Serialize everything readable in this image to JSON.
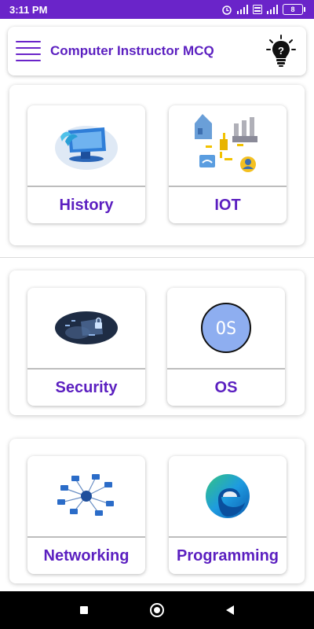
{
  "status_bar": {
    "time": "3:11 PM",
    "battery": "8",
    "icons": [
      "alarm-icon",
      "signal-icon",
      "volte-icon",
      "wifi-signal-icon",
      "battery-icon"
    ]
  },
  "app_bar": {
    "title": "Computer Instructor MCQ",
    "menu_icon": "hamburger-menu-icon",
    "action_icon": "lightbulb-idea-icon"
  },
  "categories": [
    {
      "label": "History",
      "icon": "computer-history-icon"
    },
    {
      "label": "IOT",
      "icon": "iot-network-icon"
    },
    {
      "label": "Security",
      "icon": "security-lock-icon"
    },
    {
      "label": "OS",
      "icon": "os-badge-icon",
      "badge_text": "OS"
    },
    {
      "label": "Networking",
      "icon": "network-computers-icon"
    },
    {
      "label": "Programming",
      "icon": "edge-browser-icon"
    }
  ],
  "nav_bar": {
    "icons": [
      "recent-apps-icon",
      "home-icon",
      "back-icon"
    ]
  },
  "colors": {
    "accent": "#6a24c9",
    "label": "#5b1fc0",
    "os_badge": "#8eaef0"
  }
}
